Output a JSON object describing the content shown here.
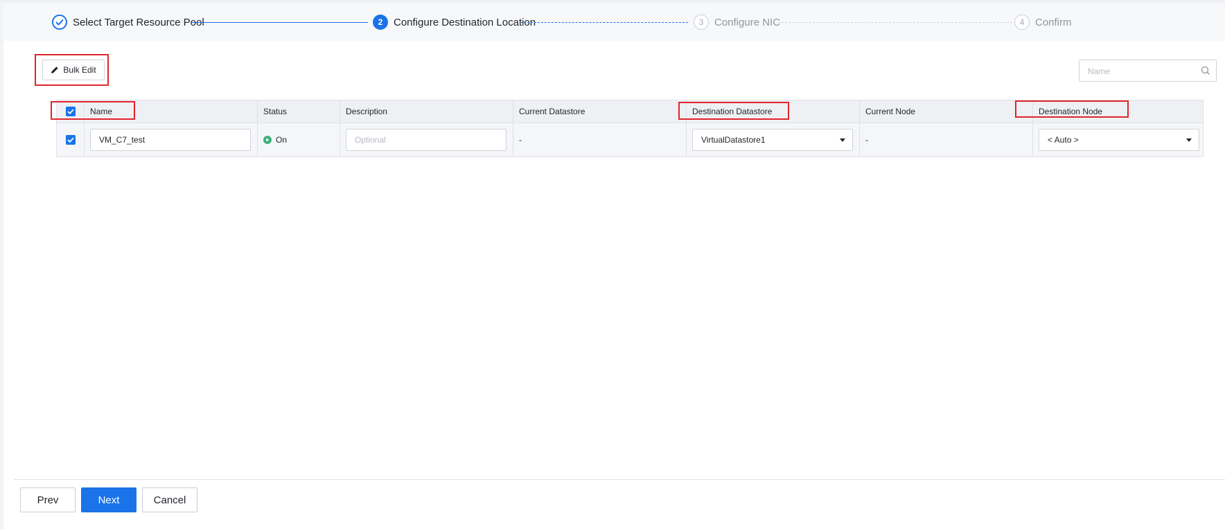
{
  "steps": [
    {
      "label": "Select Target Resource Pool",
      "state": "done"
    },
    {
      "label": "Configure Destination Location",
      "number": "2",
      "state": "active"
    },
    {
      "label": "Configure NIC",
      "number": "3",
      "state": "todo"
    },
    {
      "label": "Confirm",
      "number": "4",
      "state": "todo"
    }
  ],
  "toolbar": {
    "bulk_edit_label": "Bulk Edit",
    "bulk_edit_icon": "pencil-icon",
    "search_placeholder": "Name",
    "search_icon": "search-icon"
  },
  "table": {
    "columns": [
      "Name",
      "Status",
      "Description",
      "Current Datastore",
      "Destination Datastore",
      "Current Node",
      "Destination Node"
    ],
    "rows": [
      {
        "checked": true,
        "name": "VM_C7_test",
        "status": "On",
        "description_placeholder": "Optional",
        "current_datastore": "-",
        "destination_datastore": "VirtualDatastore1",
        "current_node": "-",
        "destination_node": "< Auto >"
      }
    ]
  },
  "footer": {
    "prev_label": "Prev",
    "next_label": "Next",
    "cancel_label": "Cancel"
  },
  "colors": {
    "accent": "#1a73e8",
    "status_on": "#3fb27f",
    "annotation": "#e0242b"
  }
}
